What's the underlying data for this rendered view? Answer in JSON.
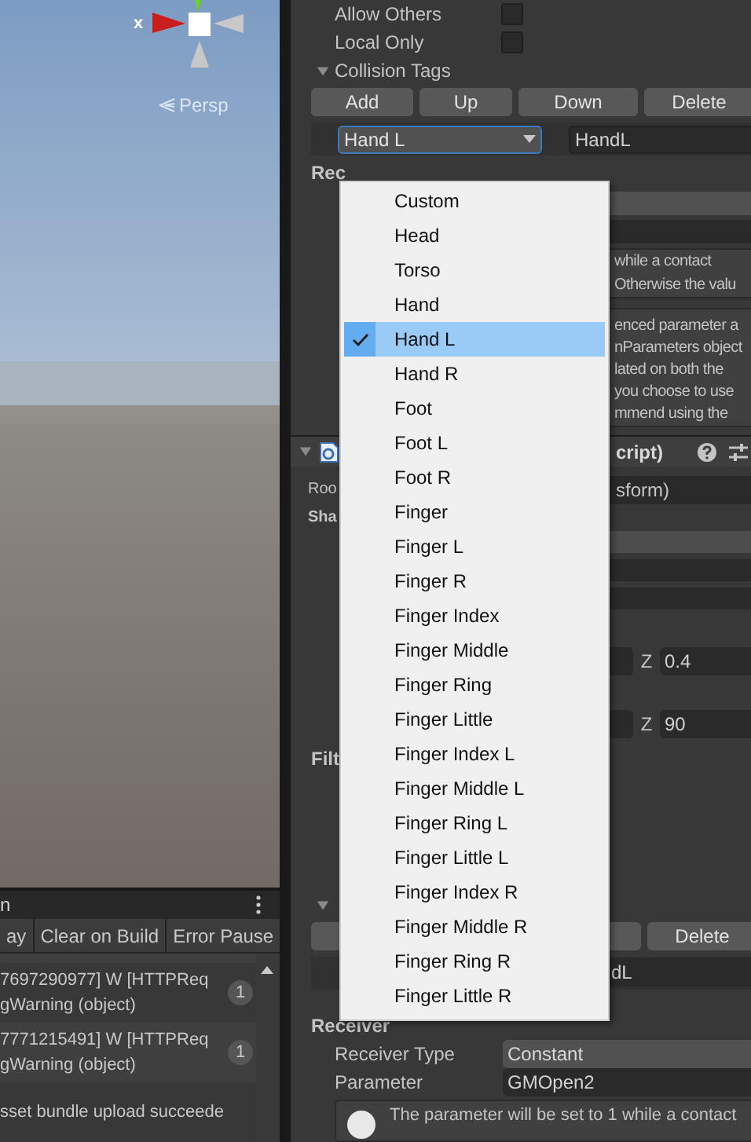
{
  "scene_view": {
    "gizmo_axis_label": "x",
    "camera_mode": "Persp"
  },
  "console": {
    "tab_title": "n",
    "toolbar": [
      "ay",
      "Clear on Build",
      "Error Pause"
    ],
    "logs": [
      {
        "lines": [
          "7697290977] W [HTTPReq",
          "gWarning (object)"
        ],
        "count": "1"
      },
      {
        "lines": [
          "7771215491] W [HTTPReq",
          "gWarning (object)"
        ],
        "count": "1"
      },
      {
        "lines": [
          "sset bundle upload succeede"
        ]
      }
    ]
  },
  "inspector": {
    "toggles": [
      {
        "label": "Allow Others",
        "checked": false
      },
      {
        "label": "Local Only",
        "checked": false
      }
    ],
    "collision_tags": {
      "title": "Collision Tags",
      "expanded": true,
      "buttons": [
        "Add",
        "Up",
        "Down",
        "Delete"
      ],
      "tag_dropdown": "Hand L",
      "tag_value": "HandL"
    },
    "receiver_heading": "Rec",
    "help_1": [
      "while a contact",
      "Otherwise the valu"
    ],
    "help_2": [
      "enced parameter a",
      "nParameters object",
      "lated on both the",
      "you choose to use",
      "mmend using the"
    ],
    "component_title": "cript)",
    "root_label": "Roo",
    "root_value": "sform)",
    "shape_heading": "Sha",
    "z_fields": [
      {
        "label": "Z",
        "value": "0.4"
      },
      {
        "label": "Z",
        "value": "90"
      }
    ],
    "filter_heading": "Filt",
    "lower_delete_button": "Delete",
    "lower_tag_value": "dL",
    "receiver": {
      "heading": "Receiver",
      "fields": [
        {
          "label": "Receiver Type",
          "value": "Constant",
          "kind": "dropdown"
        },
        {
          "label": "Parameter",
          "value": "GMOpen2",
          "kind": "text"
        }
      ],
      "help": "The parameter will be set to 1 while a contact"
    }
  },
  "dropdown_menu": {
    "items": [
      {
        "label": "Custom",
        "selected": false
      },
      {
        "label": "Head",
        "selected": false
      },
      {
        "label": "Torso",
        "selected": false
      },
      {
        "label": "Hand",
        "selected": false
      },
      {
        "label": "Hand L",
        "selected": true
      },
      {
        "label": "Hand R",
        "selected": false
      },
      {
        "label": "Foot",
        "selected": false
      },
      {
        "label": "Foot L",
        "selected": false
      },
      {
        "label": "Foot R",
        "selected": false
      },
      {
        "label": "Finger",
        "selected": false
      },
      {
        "label": "Finger L",
        "selected": false
      },
      {
        "label": "Finger R",
        "selected": false
      },
      {
        "label": "Finger Index",
        "selected": false
      },
      {
        "label": "Finger Middle",
        "selected": false
      },
      {
        "label": "Finger Ring",
        "selected": false
      },
      {
        "label": "Finger Little",
        "selected": false
      },
      {
        "label": "Finger Index L",
        "selected": false
      },
      {
        "label": "Finger Middle L",
        "selected": false
      },
      {
        "label": "Finger Ring L",
        "selected": false
      },
      {
        "label": "Finger Little L",
        "selected": false
      },
      {
        "label": "Finger Index R",
        "selected": false
      },
      {
        "label": "Finger Middle R",
        "selected": false
      },
      {
        "label": "Finger Ring R",
        "selected": false
      },
      {
        "label": "Finger Little R",
        "selected": false
      }
    ]
  }
}
